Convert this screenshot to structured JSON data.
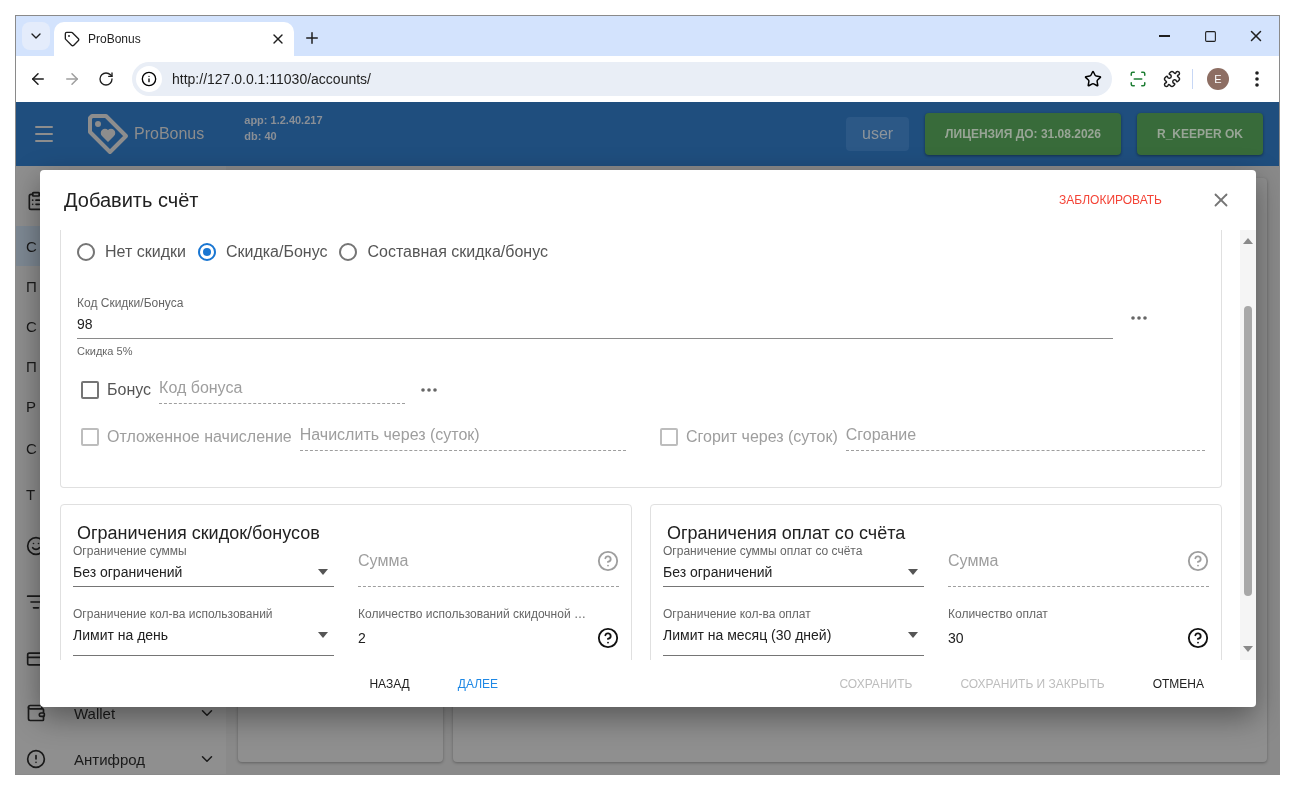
{
  "browser": {
    "tabs": [
      {
        "title": "ProBonus",
        "selected": true
      }
    ],
    "url": "http://127.0.0.1:11030/accounts/",
    "avatar": "E"
  },
  "header": {
    "brand": "ProBonus",
    "app_version": "app: 1.2.40.217",
    "db_version": "db: 40",
    "user": "user",
    "license": "ЛИЦЕНЗИЯ ДО: 31.08.2026",
    "status": "R_KEEPER OK"
  },
  "sidebar": {
    "items": [
      {
        "kind": "icon",
        "selected": false
      },
      {
        "kind": "link",
        "label": "С",
        "selected": true
      },
      {
        "kind": "link",
        "label": "П",
        "selected": false
      },
      {
        "kind": "link",
        "label": "С",
        "selected": false
      },
      {
        "kind": "link",
        "label": "П",
        "selected": false
      },
      {
        "kind": "link",
        "label": "Р",
        "selected": false
      },
      {
        "kind": "link",
        "label": "С",
        "selected": false
      },
      {
        "kind": "link",
        "label": "Т",
        "selected": false
      },
      {
        "kind": "icon",
        "selected": false
      },
      {
        "kind": "icon",
        "selected": false
      },
      {
        "kind": "icon",
        "selected": false
      },
      {
        "kind": "group",
        "label": "Wallet",
        "selected": false
      },
      {
        "kind": "group",
        "label": "Антифрод",
        "selected": false
      }
    ]
  },
  "dialog": {
    "title": "Добавить счёт",
    "block_action": "ЗАБЛОКИРОВАТЬ",
    "discount_types": [
      {
        "label": "Нет скидки",
        "selected": false
      },
      {
        "label": "Скидка/Бонус",
        "selected": true
      },
      {
        "label": "Составная скидка/бонус",
        "selected": false
      }
    ],
    "code_field": {
      "label": "Код Скидки/Бонуса",
      "value": "98",
      "helper": "Скидка 5%"
    },
    "option_rows": [
      {
        "options": [
          {
            "label": "Бонус",
            "checked": false,
            "disabled": false,
            "placeholder": "Код бонуса",
            "kind": "lookup"
          }
        ]
      },
      {
        "options": [
          {
            "label": "Отложенное начисление",
            "checked": false,
            "disabled": true,
            "placeholder": "Начислить через (суток)",
            "kind": "plain"
          },
          {
            "label": "Сгорит через (суток)",
            "checked": false,
            "disabled": true,
            "placeholder": "Сгорание",
            "kind": "plain"
          }
        ]
      }
    ],
    "limit_cards": [
      {
        "title": "Ограничения скидок/бонусов",
        "rows": [
          {
            "select": {
              "label": "Ограничение суммы",
              "value": "Без ограничений"
            },
            "field": {
              "placeholder": "Сумма",
              "disabled": true
            }
          },
          {
            "select": {
              "label": "Ограничение кол-ва использований",
              "value": "Лимит на день"
            },
            "field": {
              "label": "Количество использований скидочной …",
              "value": "2",
              "disabled": false
            }
          }
        ]
      },
      {
        "title": "Ограничения оплат со счёта",
        "rows": [
          {
            "select": {
              "label": "Ограничение суммы оплат со счёта",
              "value": "Без ограничений"
            },
            "field": {
              "placeholder": "Сумма",
              "disabled": true
            }
          },
          {
            "select": {
              "label": "Ограничение кол-ва оплат",
              "value": "Лимит на месяц (30 дней)"
            },
            "field": {
              "label": "Количество оплат",
              "value": "30",
              "disabled": false
            }
          }
        ]
      }
    ],
    "buttons": [
      {
        "label": "НАЗАД",
        "kind": "nav",
        "primary": false,
        "disabled": false
      },
      {
        "label": "ДАЛЕЕ",
        "kind": "nav",
        "primary": true,
        "disabled": false
      },
      {
        "label": "СОХРАНИТЬ",
        "kind": "action",
        "primary": false,
        "disabled": true
      },
      {
        "label": "СОХРАНИТЬ И ЗАКРЫТЬ",
        "kind": "action",
        "primary": false,
        "disabled": true
      },
      {
        "label": "ОТМЕНА",
        "kind": "action",
        "primary": false,
        "disabled": false
      }
    ]
  }
}
